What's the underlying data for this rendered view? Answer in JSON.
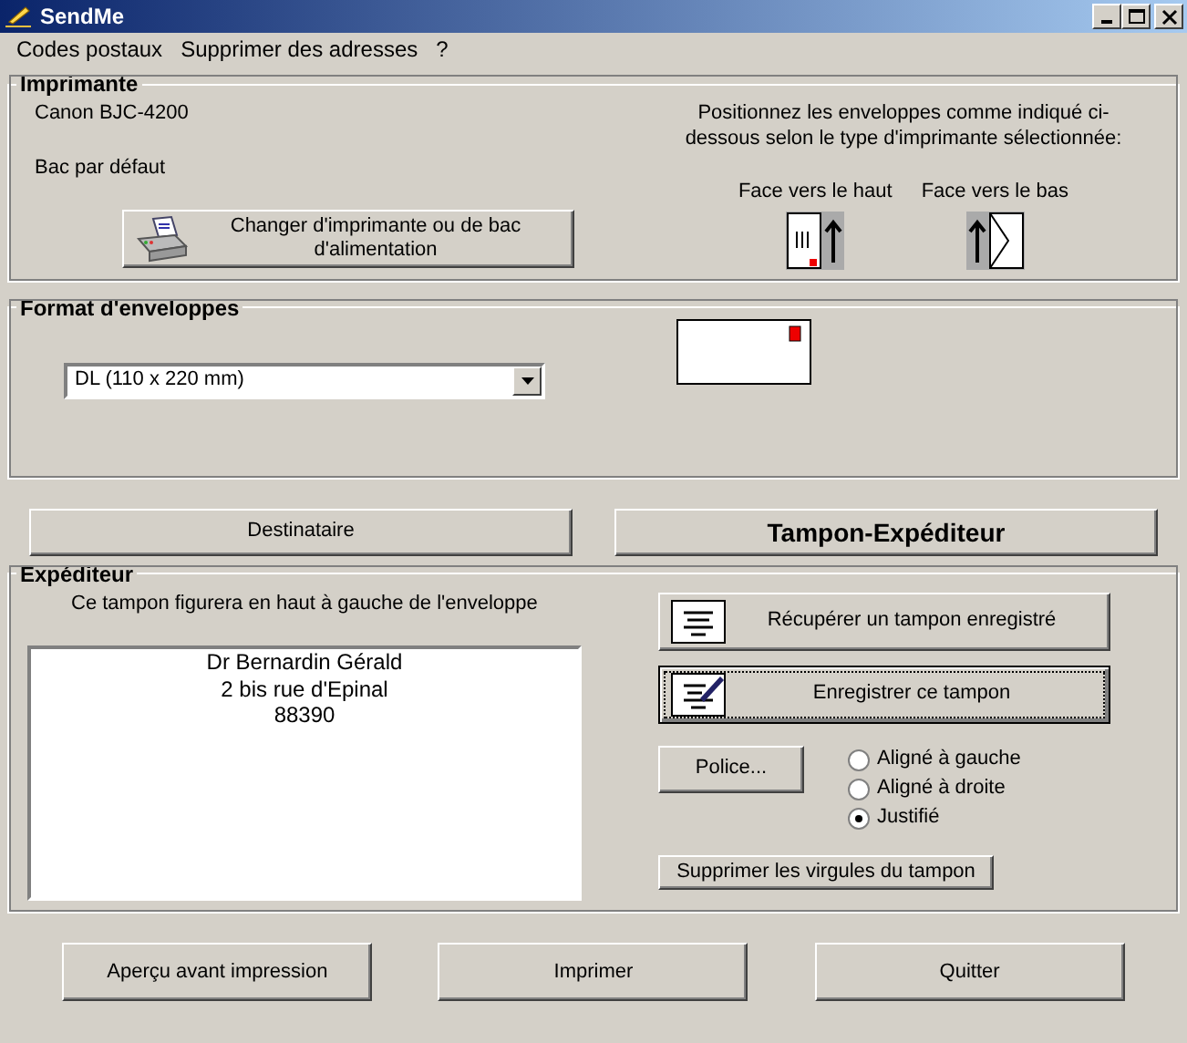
{
  "window": {
    "title": "SendMe"
  },
  "menu": [
    {
      "label": "Codes postaux"
    },
    {
      "label": "Supprimer des adresses"
    },
    {
      "label": "?"
    }
  ],
  "printer": {
    "title": "Imprimante",
    "name": "Canon  BJC-4200",
    "tray": "Bac par défaut",
    "change_button": "Changer d'imprimante ou de bac d'alimentation",
    "instructions": "Positionnez les enveloppes comme indiqué ci-dessous selon le type d'imprimante sélectionnée:",
    "orientations": [
      {
        "label": "Face vers le haut",
        "kind": "up"
      },
      {
        "label": "Face vers le bas",
        "kind": "down"
      }
    ]
  },
  "envelope_format": {
    "title": "Format d'enveloppes",
    "value": "DL (110 x 220 mm)"
  },
  "tabs": [
    {
      "label": "Destinataire",
      "selected": false
    },
    {
      "label": "Tampon-Expéditeur",
      "selected": true
    }
  ],
  "sender": {
    "title": "Expéditeur",
    "hint": "Ce tampon figurera en haut à gauche de l'enveloppe",
    "stamp_lines": [
      "Dr Bernardin Gérald",
      "2 bis rue d'Epinal",
      "88390"
    ],
    "buttons": [
      {
        "label": "Récupérer un tampon enregistré",
        "kind": "load",
        "focused": false
      },
      {
        "label": "Enregistrer ce tampon",
        "kind": "save",
        "focused": true
      }
    ],
    "font_button": "Police...",
    "alignments": [
      {
        "label": "Aligné à gauche",
        "selected": false
      },
      {
        "label": "Aligné à droite",
        "selected": false
      },
      {
        "label": "Justifié",
        "selected": true
      }
    ],
    "remove_commas_button": "Supprimer les virgules du tampon"
  },
  "footer_buttons": [
    {
      "label": "Aperçu avant impression"
    },
    {
      "label": "Imprimer"
    },
    {
      "label": "Quitter"
    }
  ]
}
